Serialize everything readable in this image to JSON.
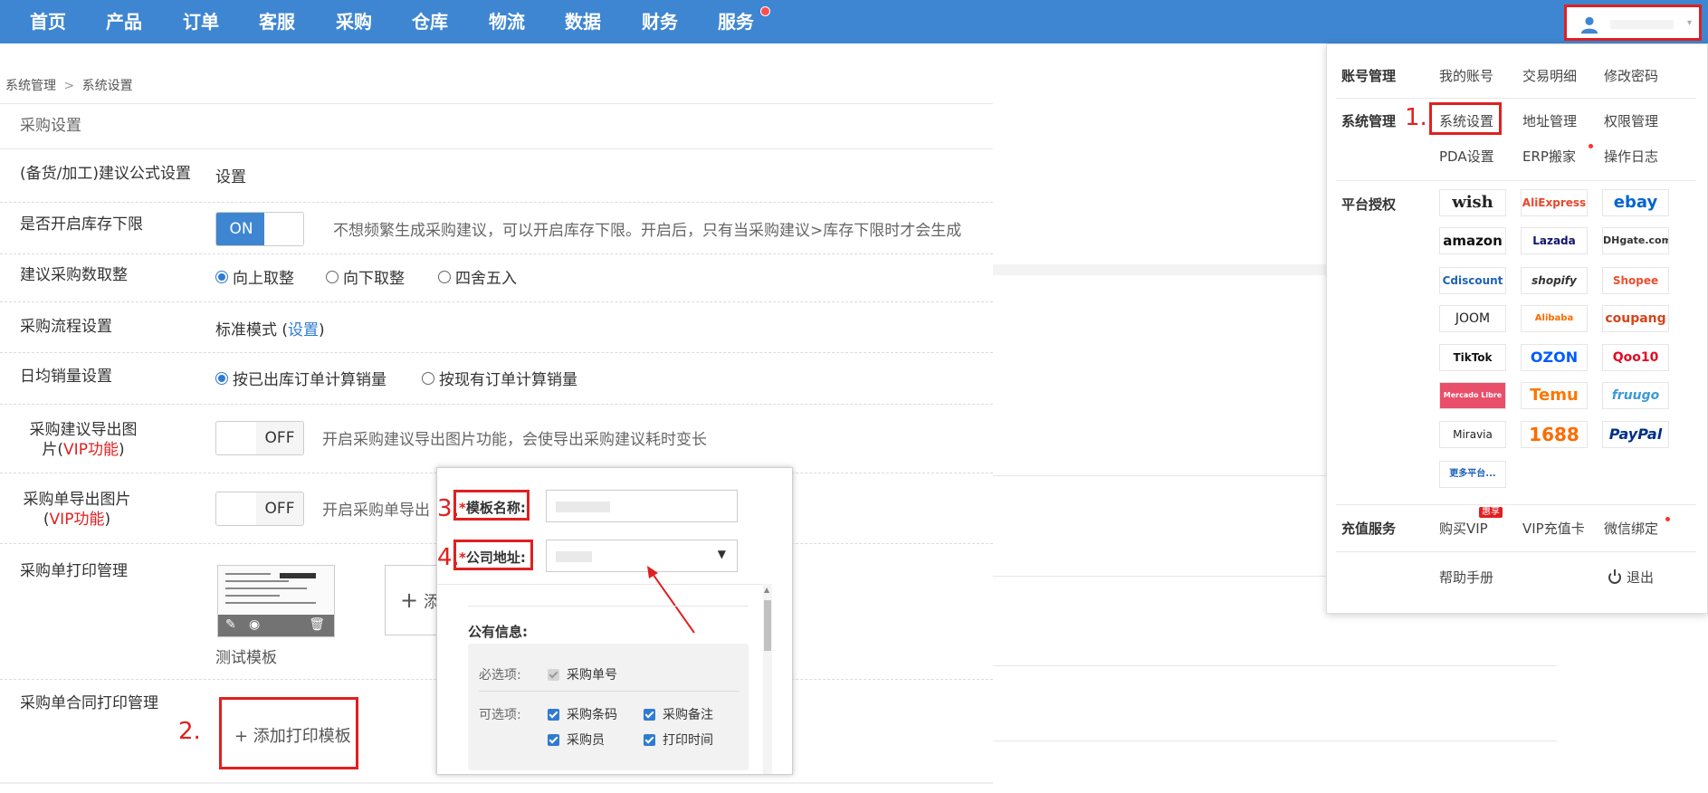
{
  "nav": {
    "items": [
      "首页",
      "产品",
      "订单",
      "客服",
      "采购",
      "仓库",
      "物流",
      "数据",
      "财务",
      "服务"
    ]
  },
  "breadcrumb": {
    "parent": "系统管理",
    "separator": ">",
    "current": "系统设置"
  },
  "panel": {
    "title": "采购设置",
    "formula": {
      "label": "(备货/加工)建议公式设置",
      "link": "设置"
    },
    "stock_limit": {
      "label": "是否开启库存下限",
      "toggle": "ON",
      "hint": "不想频繁生成采购建议，可以开启库存下限。开启后，只有当采购建议>库存下限时才会生成"
    },
    "rounding": {
      "label": "建议采购数取整",
      "options": [
        "向上取整",
        "向下取整",
        "四舍五入"
      ],
      "selected": "向上取整"
    },
    "process": {
      "label": "采购流程设置",
      "mode": "标准模式",
      "open": "(",
      "link": "设置",
      "close": ")"
    },
    "daily_sales": {
      "label": "日均销量设置",
      "options": [
        "按已出库订单计算销量",
        "按现有订单计算销量"
      ],
      "selected": "按已出库订单计算销量"
    },
    "export_image": {
      "label_a": "采购建议导出图",
      "label_b": "片(",
      "label_vip": "VIP功能",
      "label_c": ")",
      "toggle": "OFF",
      "hint": "开启采购建议导出图片功能，会使导出采购建议耗时变长"
    },
    "order_image": {
      "label_a": "采购单导出图片",
      "label_b": "(",
      "label_vip": "VIP功能",
      "label_c": ")",
      "toggle": "OFF",
      "hint": "开启采购单导出"
    },
    "print_mgmt": {
      "label": "采购单打印管理",
      "template_name": "测试模板",
      "add_symbol": "+",
      "add_text": "添"
    },
    "contract_print": {
      "label": "采购单合同打印管理",
      "add_button": "+ 添加打印模板"
    }
  },
  "steps": {
    "s1": "1.",
    "s2": "2.",
    "s3": "3.",
    "s4": "4."
  },
  "dialog": {
    "template_name_label": "模板名称:",
    "company_address_label": "公司地址:",
    "required_mark": "*",
    "public_info_title": "公有信息:",
    "required_label": "必选项:",
    "required_items": [
      "采购单号"
    ],
    "optional_label": "可选项:",
    "optional_items": [
      "采购条码",
      "采购备注",
      "采购员",
      "打印时间"
    ]
  },
  "account_menu": {
    "sections": {
      "account": {
        "title": "账号管理",
        "items": [
          "我的账号",
          "交易明细",
          "修改密码"
        ]
      },
      "system": {
        "title": "系统管理",
        "items": [
          "系统设置",
          "地址管理",
          "权限管理",
          "PDA设置",
          "ERP搬家",
          "操作日志"
        ]
      },
      "platform": {
        "title": "平台授权"
      },
      "recharge": {
        "title": "充值服务",
        "items": [
          "购买VIP",
          "VIP充值卡",
          "微信绑定"
        ]
      }
    },
    "vip_badge": "惠享",
    "help": "帮助手册",
    "logout": "退出",
    "more_platforms": "更多平台...",
    "platforms": [
      "wish",
      "AliExpress",
      "ebay",
      "amazon",
      "Lazada",
      "DHgate.com",
      "Cdiscount",
      "shopify",
      "Shopee",
      "JOOM",
      "Alibaba",
      "coupang",
      "TikTok",
      "OZON",
      "Qoo10",
      "Mercado Libre",
      "Temu",
      "fruugo",
      "Miravia",
      "1688",
      "PayPal"
    ]
  },
  "colors": {
    "nav_bg": "#3e86d1",
    "accent": "#2f7bd1",
    "annotation": "#e02020"
  }
}
